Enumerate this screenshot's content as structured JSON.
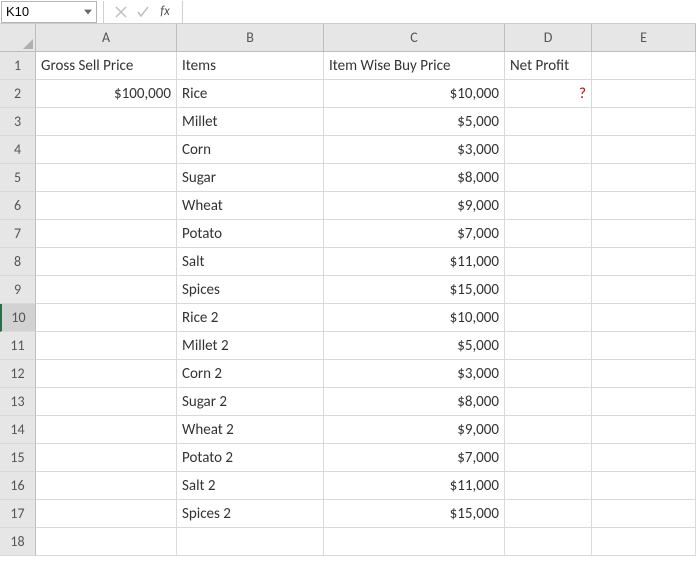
{
  "formula_bar": {
    "name_box_value": "K10",
    "fx_label": "fx",
    "formula_value": ""
  },
  "columns": [
    "A",
    "B",
    "C",
    "D",
    "E"
  ],
  "headers": {
    "A": "Gross Sell Price",
    "B": "Items",
    "C": "Item Wise Buy Price",
    "D": "Net Profit"
  },
  "gross_sell_price": "$100,000",
  "net_profit_placeholder": "?",
  "rows": [
    {
      "n": 2,
      "item": "Rice",
      "price": "$10,000"
    },
    {
      "n": 3,
      "item": "Millet",
      "price": "$5,000"
    },
    {
      "n": 4,
      "item": "Corn",
      "price": "$3,000"
    },
    {
      "n": 5,
      "item": "Sugar",
      "price": "$8,000"
    },
    {
      "n": 6,
      "item": "Wheat",
      "price": "$9,000"
    },
    {
      "n": 7,
      "item": "Potato",
      "price": "$7,000"
    },
    {
      "n": 8,
      "item": "Salt",
      "price": "$11,000"
    },
    {
      "n": 9,
      "item": "Spices",
      "price": "$15,000"
    },
    {
      "n": 10,
      "item": "Rice 2",
      "price": "$10,000"
    },
    {
      "n": 11,
      "item": "Millet 2",
      "price": "$5,000"
    },
    {
      "n": 12,
      "item": "Corn 2",
      "price": "$3,000"
    },
    {
      "n": 13,
      "item": "Sugar 2",
      "price": "$8,000"
    },
    {
      "n": 14,
      "item": "Wheat 2",
      "price": "$9,000"
    },
    {
      "n": 15,
      "item": "Potato 2",
      "price": "$7,000"
    },
    {
      "n": 16,
      "item": "Salt 2",
      "price": "$11,000"
    },
    {
      "n": 17,
      "item": "Spices 2",
      "price": "$15,000"
    }
  ],
  "blank_rows": [
    18
  ]
}
